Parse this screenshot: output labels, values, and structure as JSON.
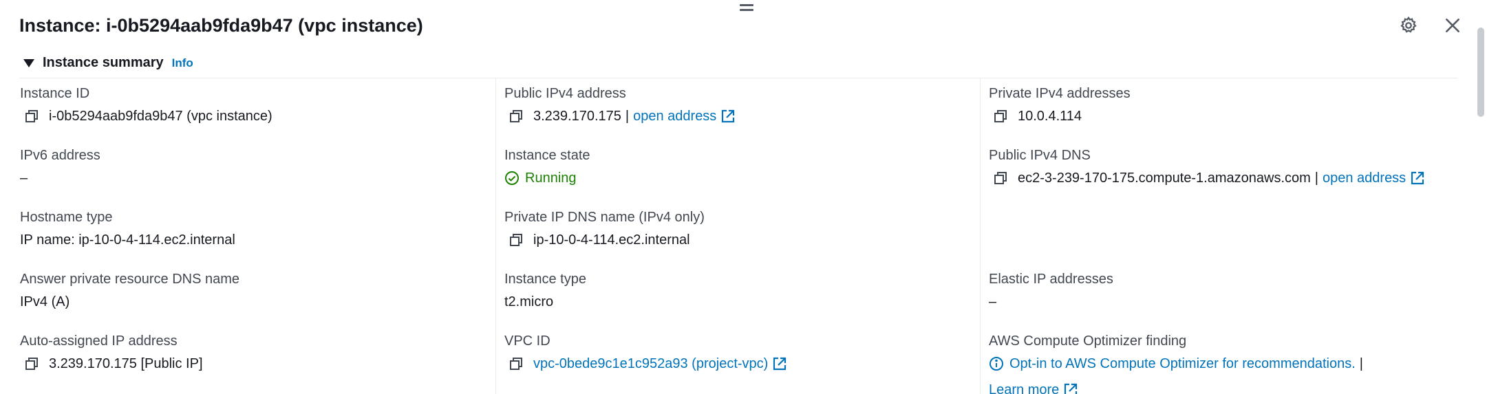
{
  "header": {
    "title": "Instance: i-0b5294aab9fda9b47 (vpc instance)",
    "settings_icon": "gear-icon",
    "close_icon": "close-icon"
  },
  "section": {
    "title": "Instance summary",
    "info": "Info"
  },
  "col1": {
    "instance_id_label": "Instance ID",
    "instance_id_value": "i-0b5294aab9fda9b47 (vpc instance)",
    "ipv6_label": "IPv6 address",
    "ipv6_value": "–",
    "hostname_type_label": "Hostname type",
    "hostname_type_value": "IP name: ip-10-0-4-114.ec2.internal",
    "answer_dns_label": "Answer private resource DNS name",
    "answer_dns_value": "IPv4 (A)",
    "auto_ip_label": "Auto-assigned IP address",
    "auto_ip_value": "3.239.170.175 [Public IP]"
  },
  "col2": {
    "public_ipv4_label": "Public IPv4 address",
    "public_ipv4_value": "3.239.170.175",
    "public_ipv4_sep": "|",
    "public_ipv4_link": "open address",
    "instance_state_label": "Instance state",
    "instance_state_value": "Running",
    "private_dns_label": "Private IP DNS name (IPv4 only)",
    "private_dns_value": "ip-10-0-4-114.ec2.internal",
    "instance_type_label": "Instance type",
    "instance_type_value": "t2.micro",
    "vpc_id_label": "VPC ID",
    "vpc_id_value": "vpc-0bede9c1e1c952a93 (project-vpc)"
  },
  "col3": {
    "private_ipv4_label": "Private IPv4 addresses",
    "private_ipv4_value": "10.0.4.114",
    "public_dns_label": "Public IPv4 DNS",
    "public_dns_value": "ec2-3-239-170-175.compute-1.amazonaws.com",
    "public_dns_sep": "|",
    "public_dns_link": "open address",
    "elastic_ip_label": "Elastic IP addresses",
    "elastic_ip_value": "–",
    "optimizer_label": "AWS Compute Optimizer finding",
    "optimizer_link": "Opt-in to AWS Compute Optimizer for recommendations.",
    "optimizer_sep": "|",
    "learn_more": "Learn more"
  },
  "colors": {
    "link": "#0073bb",
    "running": "#1d8102",
    "label": "#414750",
    "text": "#16191f"
  }
}
